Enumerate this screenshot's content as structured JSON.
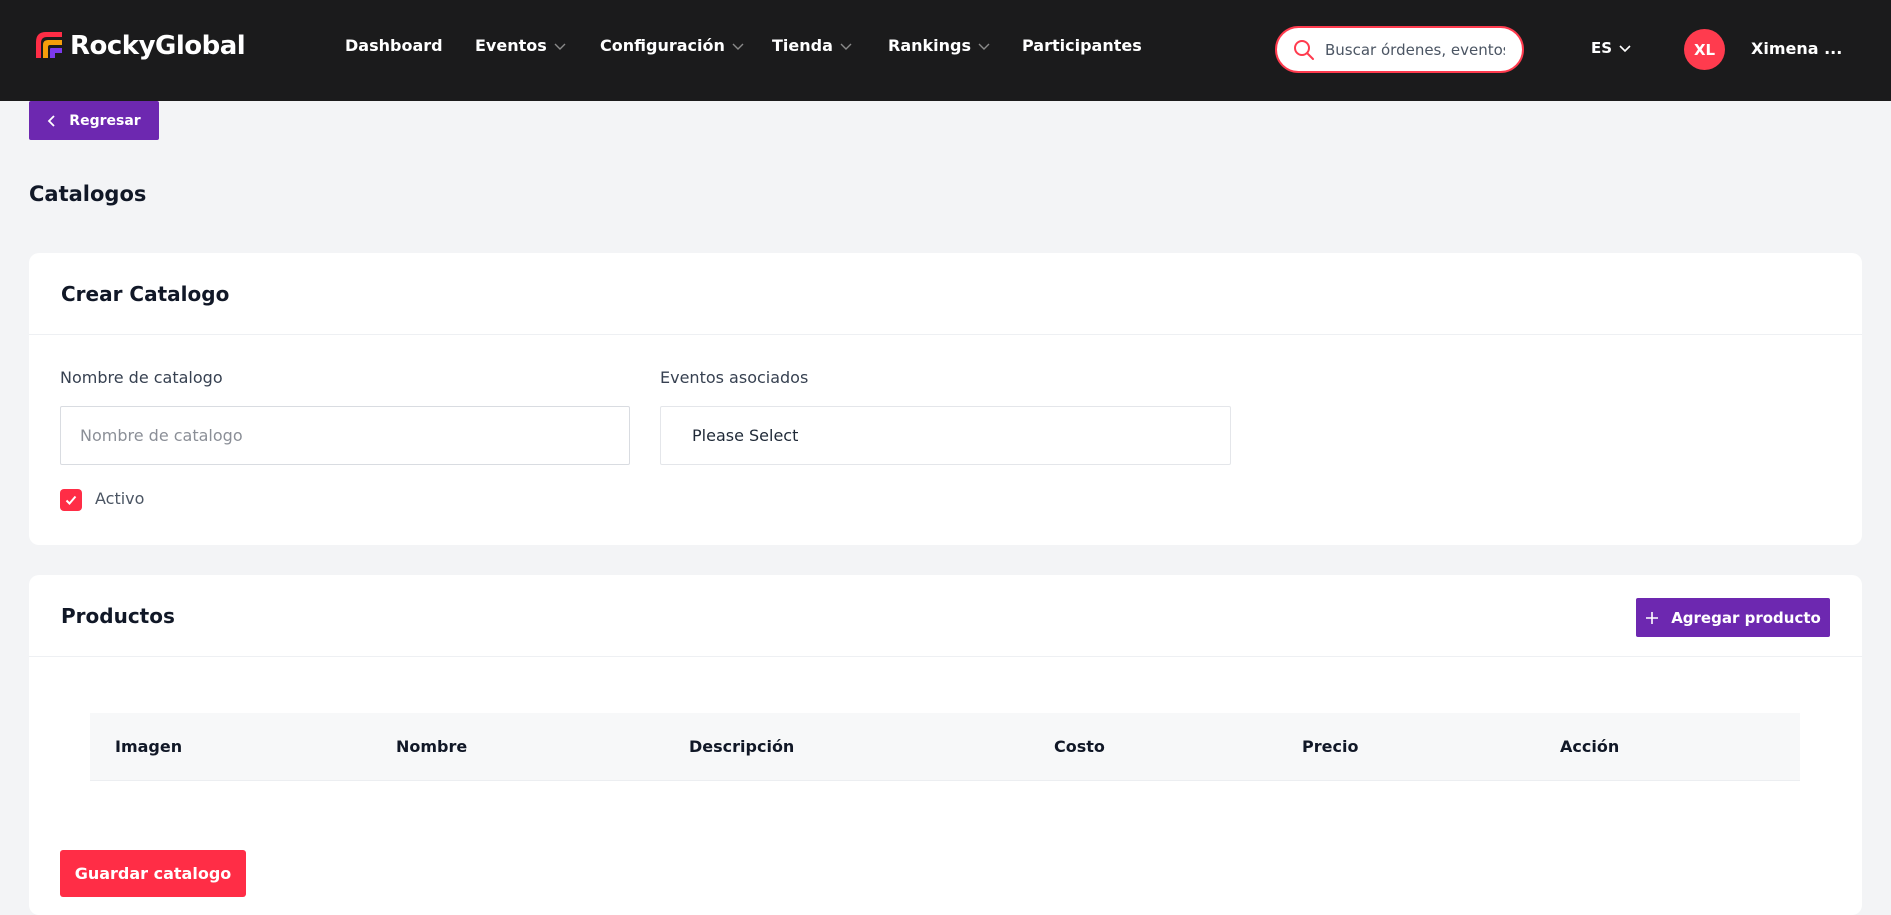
{
  "brand": {
    "name": "RockyGlobal"
  },
  "nav": {
    "items": [
      {
        "label": "Dashboard",
        "dropdown": false
      },
      {
        "label": "Eventos",
        "dropdown": true
      },
      {
        "label": "Configuración",
        "dropdown": true
      },
      {
        "label": "Tienda",
        "dropdown": true
      },
      {
        "label": "Rankings",
        "dropdown": true
      },
      {
        "label": "Participantes",
        "dropdown": false
      }
    ]
  },
  "search": {
    "placeholder": "Buscar órdenes, eventos"
  },
  "language": {
    "selected": "ES"
  },
  "user": {
    "initials": "XL",
    "name": "Ximena ..."
  },
  "back_button": {
    "label": "Regresar"
  },
  "page": {
    "title": "Catalogos"
  },
  "create_card": {
    "title": "Crear Catalogo",
    "name_field": {
      "label": "Nombre de catalogo",
      "placeholder": "Nombre de catalogo",
      "value": ""
    },
    "events_field": {
      "label": "Eventos asociados",
      "value": "Please Select"
    },
    "active": {
      "label": "Activo",
      "checked": true
    }
  },
  "products_card": {
    "title": "Productos",
    "add_button": "Agregar producto",
    "columns": [
      "Imagen",
      "Nombre",
      "Descripción",
      "Costo",
      "Precio",
      "Acción"
    ],
    "rows": []
  },
  "save_button": {
    "label": "Guardar catalogo"
  },
  "colors": {
    "navbar": "#1b1b1c",
    "primary": "#6d28b0",
    "accent": "#ff2d46",
    "background": "#f3f4f6"
  }
}
